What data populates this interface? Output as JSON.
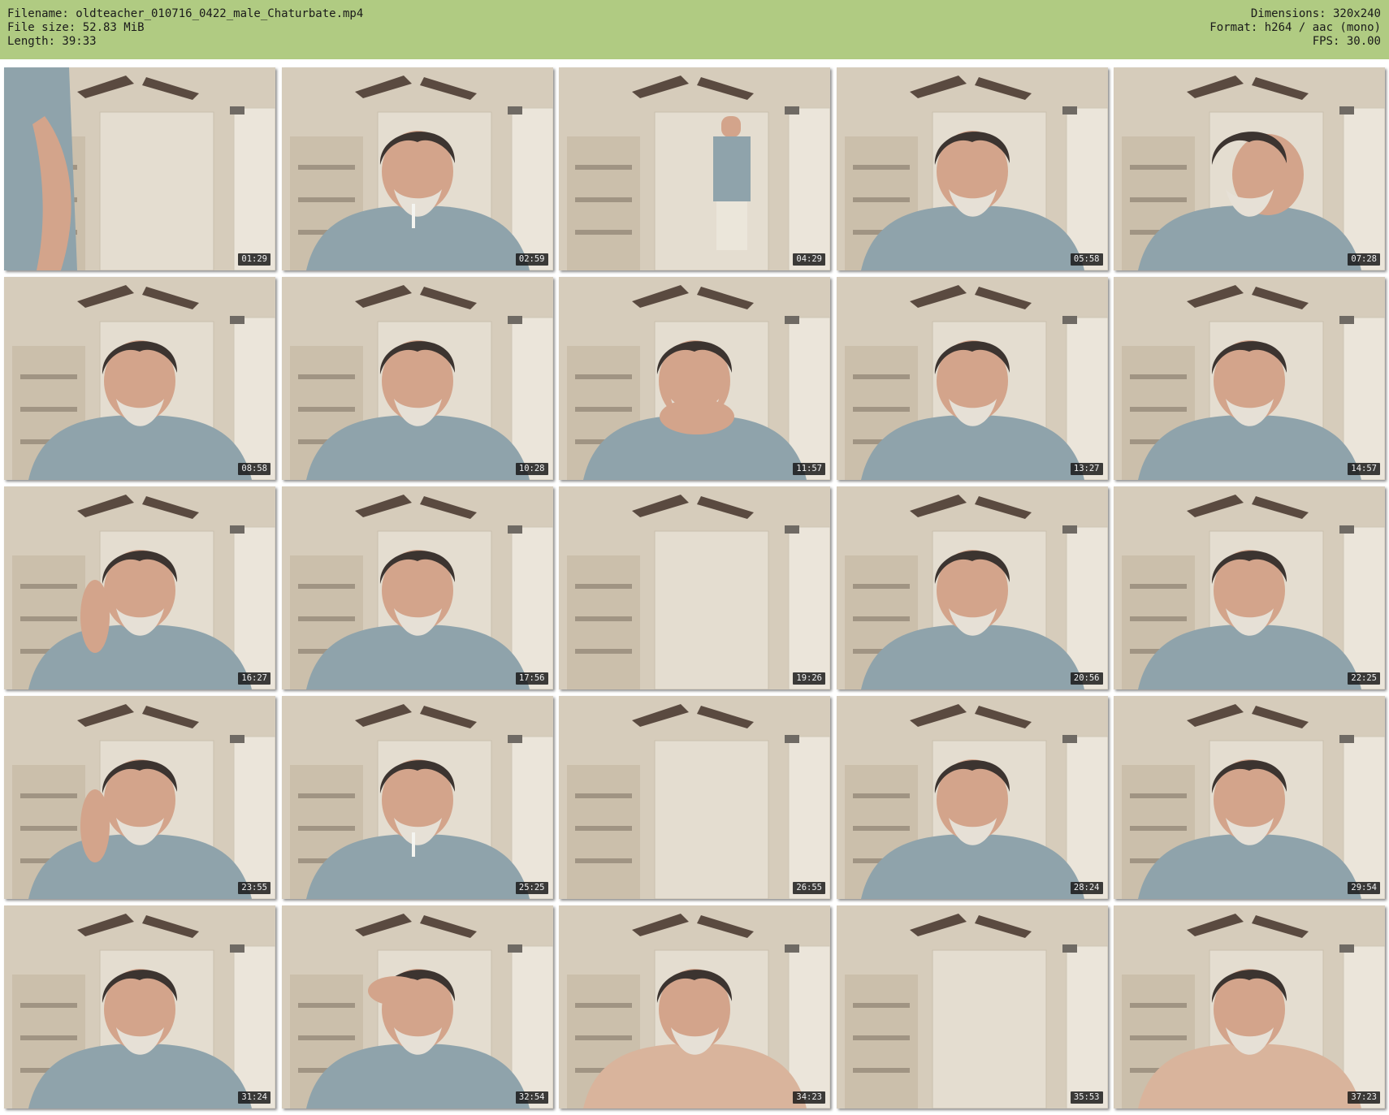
{
  "header": {
    "filename": "Filename: oldteacher_010716_0422_male_Chaturbate.mp4",
    "filesize": "File size: 52.83 MiB",
    "length": "Length: 39:33",
    "dimensions": "Dimensions: 320x240",
    "format": "Format: h264 / aac (mono)",
    "fps": "FPS: 30.00"
  },
  "colors": {
    "header_bg": "#b0cb82",
    "wall": "#d6ccbb",
    "shirt": "#8fa3ab",
    "skin": "#d3a48b",
    "hair": "#3c3430"
  },
  "thumbnails": [
    {
      "time": "01:29",
      "scene": "arm-closeup"
    },
    {
      "time": "02:59",
      "scene": "smoking"
    },
    {
      "time": "04:29",
      "scene": "standing"
    },
    {
      "time": "05:58",
      "scene": "seated"
    },
    {
      "time": "07:28",
      "scene": "leaning"
    },
    {
      "time": "08:58",
      "scene": "seated"
    },
    {
      "time": "10:28",
      "scene": "seated"
    },
    {
      "time": "11:57",
      "scene": "hand-chin"
    },
    {
      "time": "13:27",
      "scene": "seated"
    },
    {
      "time": "14:57",
      "scene": "seated"
    },
    {
      "time": "16:27",
      "scene": "hand-cheek"
    },
    {
      "time": "17:56",
      "scene": "seated"
    },
    {
      "time": "19:26",
      "scene": "empty"
    },
    {
      "time": "20:56",
      "scene": "seated"
    },
    {
      "time": "22:25",
      "scene": "seated"
    },
    {
      "time": "23:55",
      "scene": "hand-cheek"
    },
    {
      "time": "25:25",
      "scene": "smoking"
    },
    {
      "time": "26:55",
      "scene": "empty"
    },
    {
      "time": "28:24",
      "scene": "seated"
    },
    {
      "time": "29:54",
      "scene": "seated"
    },
    {
      "time": "31:24",
      "scene": "seated"
    },
    {
      "time": "32:54",
      "scene": "hand-forehead"
    },
    {
      "time": "34:23",
      "scene": "shirtless"
    },
    {
      "time": "35:53",
      "scene": "empty"
    },
    {
      "time": "37:23",
      "scene": "shirtless"
    }
  ]
}
